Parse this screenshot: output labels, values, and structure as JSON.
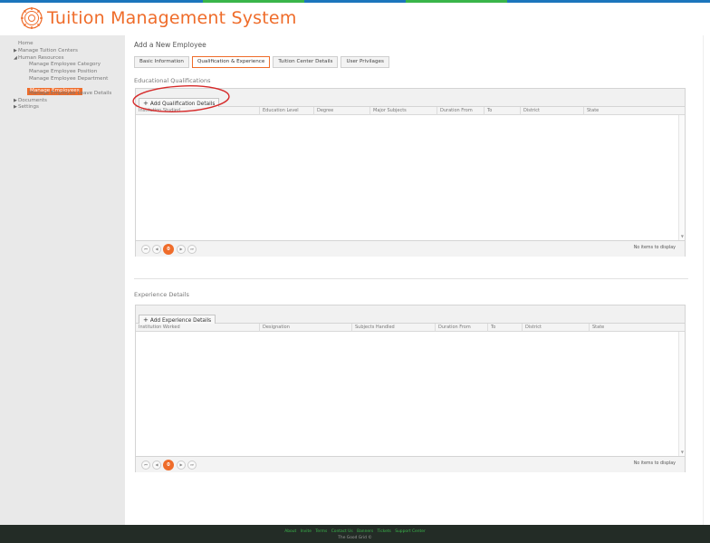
{
  "app": {
    "title": "Tuition Management System"
  },
  "colors": {
    "accent": "#ef6c2a",
    "stripe": [
      "#1b75bc",
      "#39b54a",
      "#1b75bc",
      "#ef6c2a",
      "#39b54a",
      "#1b75bc"
    ],
    "annotation": "#d62a2a"
  },
  "sidebar": {
    "items": [
      {
        "label": "Home"
      },
      {
        "label": "Manage Tuition Centers"
      },
      {
        "label": "Human Resources"
      },
      {
        "label": "Manage Employee Category"
      },
      {
        "label": "Manage Employee Position"
      },
      {
        "label": "Manage Employee Department"
      },
      {
        "label": "Manage Employees"
      },
      {
        "label": "Manage Employee Leave Details"
      },
      {
        "label": "Documents"
      },
      {
        "label": "Settings"
      }
    ]
  },
  "main": {
    "heading": "Add a New Employee",
    "tabs": [
      {
        "label": "Basic Information"
      },
      {
        "label": "Qualification & Experience"
      },
      {
        "label": "Tuition Center Details"
      },
      {
        "label": "User Privilages"
      }
    ],
    "education": {
      "title": "Educational Qualifications",
      "add_button": "Add Qualification Details",
      "columns": [
        "Institution Studied",
        "Education Level",
        "Degree",
        "Major Subjects",
        "Duration From",
        "To",
        "District",
        "State"
      ],
      "page": "0",
      "info": "No items to display"
    },
    "experience": {
      "title": "Experience Details",
      "add_button": "Add Experience Details",
      "columns": [
        "Institution Worked",
        "Designation",
        "Subjects Handled",
        "Duration From",
        "To",
        "District",
        "State"
      ],
      "page": "0",
      "info": "No items to display"
    }
  },
  "footer": {
    "links": [
      "About",
      "Invite",
      "Terms",
      "Contact Us",
      "Banners",
      "Tickets",
      "Support Center"
    ],
    "copyright": "The Good Grid ©"
  },
  "icons": {
    "first": "first-page-icon",
    "prev": "prev-page-icon",
    "next": "next-page-icon",
    "last": "last-page-icon",
    "add": "plus-icon",
    "expand": "triangle-icon",
    "logo": "gear-logo-icon"
  }
}
